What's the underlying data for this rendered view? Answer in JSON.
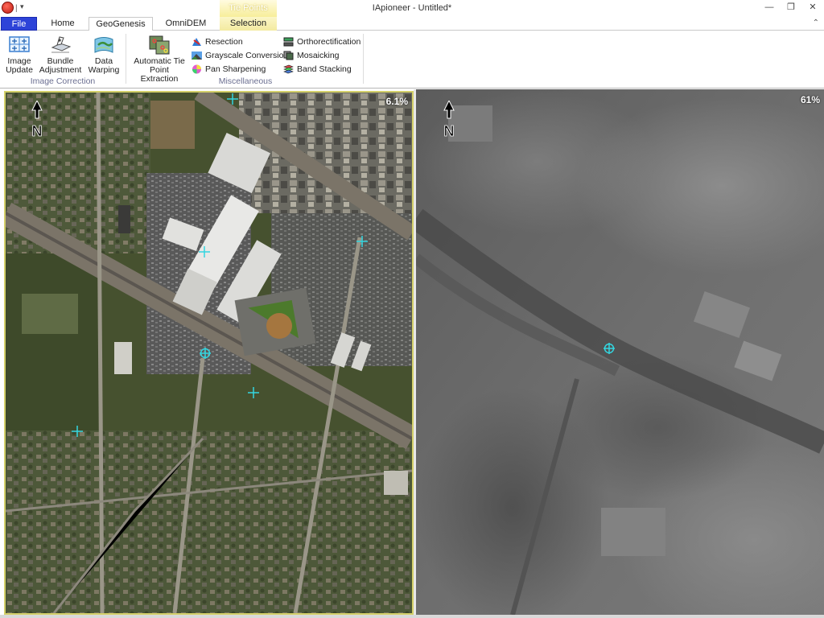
{
  "window": {
    "title": "IApioneer - Untitled*",
    "context_group": "Tie Points",
    "controls": {
      "minimize": "—",
      "restore": "❐",
      "close": "✕"
    },
    "qat_separator": "|",
    "qat_dropdown": "▾"
  },
  "tabs": [
    {
      "label": "File"
    },
    {
      "label": "Home"
    },
    {
      "label": "GeoGenesis"
    },
    {
      "label": "OmniDEM"
    },
    {
      "label": "Selection"
    }
  ],
  "active_tab": "GeoGenesis",
  "ribbon_collapse_icon": "⌃",
  "ribbon": {
    "image_correction": {
      "label": "Image Correction",
      "buttons": [
        {
          "label_line1": "Image",
          "label_line2": "Update",
          "icon": "image-update-icon"
        },
        {
          "label_line1": "Bundle",
          "label_line2": "Adjustment",
          "icon": "bundle-adjustment-icon"
        },
        {
          "label_line1": "Data",
          "label_line2": "Warping",
          "icon": "data-warping-icon"
        }
      ]
    },
    "miscellaneous": {
      "label": "Miscellaneous",
      "big_button": {
        "label_line1": "Automatic Tie",
        "label_line2": "Point Extraction",
        "icon": "tie-point-extraction-icon"
      },
      "col1": [
        {
          "label": "Resection",
          "icon": "resection-icon"
        },
        {
          "label": "Grayscale Conversion",
          "icon": "grayscale-icon"
        },
        {
          "label": "Pan Sharpening",
          "icon": "pan-sharpening-icon"
        }
      ],
      "col2": [
        {
          "label": "Orthorectification",
          "icon": "orthorectification-icon"
        },
        {
          "label": "Mosaicking",
          "icon": "mosaicking-icon"
        },
        {
          "label": "Band Stacking",
          "icon": "band-stacking-icon"
        }
      ]
    }
  },
  "views": {
    "left": {
      "zoom": "6.1%",
      "north_label": "N"
    },
    "right": {
      "zoom": "61%",
      "north_label": "N"
    }
  },
  "colors": {
    "file_tab": "#2d43d8",
    "context_tab": "#f3eaa0",
    "active_view_border": "#d4d06a",
    "tie_point": "#33d6e0",
    "group_label": "#6b6f91"
  }
}
